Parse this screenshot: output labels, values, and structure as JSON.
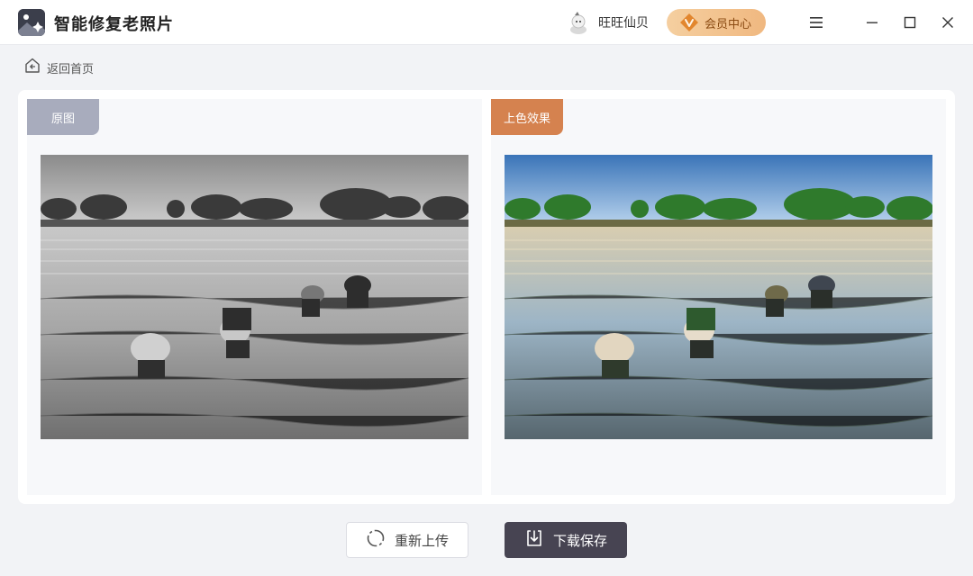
{
  "app": {
    "title": "智能修复老照片",
    "logo_icon": "photo-restore-icon"
  },
  "header": {
    "user_name": "旺旺仙贝",
    "vip_label": "会员中心",
    "vip_icon": "vip-diamond-icon",
    "menu_icon": "hamburger-menu-icon",
    "minimize_icon": "minimize-icon",
    "maximize_icon": "maximize-icon",
    "close_icon": "close-icon"
  },
  "nav": {
    "back_label": "返回首页",
    "back_icon": "home-back-icon"
  },
  "compare": {
    "original_label": "原图",
    "colorized_label": "上色效果"
  },
  "actions": {
    "reupload_label": "重新上传",
    "reupload_icon": "refresh-icon",
    "save_label": "下载保存",
    "save_icon": "download-icon"
  },
  "colors": {
    "accent_vip": "#f0b880",
    "tag_original": "#a8acbd",
    "tag_colorized": "#d5824f",
    "save_button": "#474452"
  }
}
